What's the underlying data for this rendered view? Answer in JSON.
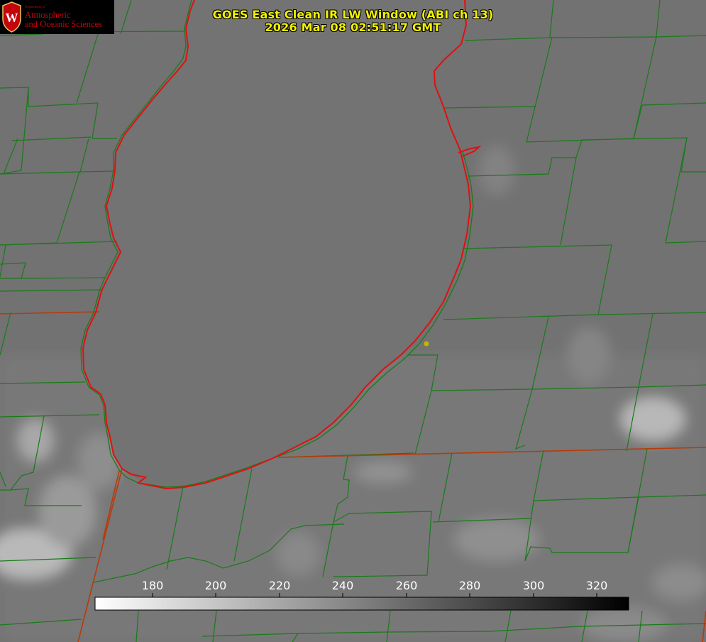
{
  "header": {
    "title_line1": "GOES East Clean IR LW Window (ABI ch 13)",
    "title_line2": "2026 Mar 08 02:51:17 GMT"
  },
  "logo": {
    "department": "Department of",
    "line1": "Atmospheric",
    "line2": "and Oceanic Sciences",
    "crest_letter": "W",
    "crest_color": "#c5050c"
  },
  "colorbar": {
    "ticks": [
      "180",
      "200",
      "220",
      "240",
      "260",
      "280",
      "300",
      "320"
    ],
    "tick_values": [
      180,
      200,
      220,
      240,
      260,
      280,
      300,
      320
    ],
    "value_range": [
      163,
      331
    ],
    "gradient": [
      "#ffffff",
      "#000000"
    ]
  },
  "map_colors": {
    "county_lines": "#1a7a1a",
    "coastline": "#e01010",
    "state_lines": "#b83a0a",
    "marker": "#c8b400",
    "lake": "#737373"
  }
}
